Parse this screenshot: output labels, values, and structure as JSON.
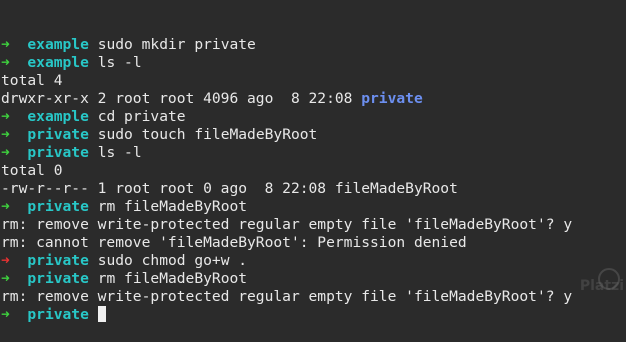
{
  "colors": {
    "background": "#2b2b2b",
    "text": "#e8e8e8",
    "arrow_success": "#3ed13e",
    "arrow_error": "#e83232",
    "prompt_dir": "#28c7c7",
    "listing_directory": "#6c8ff0"
  },
  "arrow": "➜",
  "lines": [
    {
      "type": "prompt",
      "status": "ok",
      "dir": "example",
      "cmd": "sudo mkdir private"
    },
    {
      "type": "prompt",
      "status": "ok",
      "dir": "example",
      "cmd": "ls -l"
    },
    {
      "type": "output",
      "text": "total 4"
    },
    {
      "type": "output-dir",
      "text": "drwxr-xr-x 2 root root 4096 ago  8 22:08 ",
      "name": "private"
    },
    {
      "type": "prompt",
      "status": "ok",
      "dir": "example",
      "cmd": "cd private"
    },
    {
      "type": "prompt",
      "status": "ok",
      "dir": "private",
      "cmd": "sudo touch fileMadeByRoot"
    },
    {
      "type": "prompt",
      "status": "ok",
      "dir": "private",
      "cmd": "ls -l"
    },
    {
      "type": "output",
      "text": "total 0"
    },
    {
      "type": "output",
      "text": "-rw-r--r-- 1 root root 0 ago  8 22:08 fileMadeByRoot"
    },
    {
      "type": "prompt",
      "status": "ok",
      "dir": "private",
      "cmd": "rm fileMadeByRoot"
    },
    {
      "type": "output",
      "text": "rm: remove write-protected regular empty file 'fileMadeByRoot'? y"
    },
    {
      "type": "output",
      "text": "rm: cannot remove 'fileMadeByRoot': Permission denied"
    },
    {
      "type": "prompt",
      "status": "error",
      "dir": "private",
      "cmd": "sudo chmod go+w ."
    },
    {
      "type": "prompt",
      "status": "ok",
      "dir": "private",
      "cmd": "rm fileMadeByRoot"
    },
    {
      "type": "output",
      "text": "rm: remove write-protected regular empty file 'fileMadeByRoot'? y"
    },
    {
      "type": "prompt",
      "status": "ok",
      "dir": "private",
      "cmd": "",
      "cursor": true
    }
  ],
  "watermark": {
    "text": "Platzi",
    "icon": "platzi-logo-icon"
  }
}
